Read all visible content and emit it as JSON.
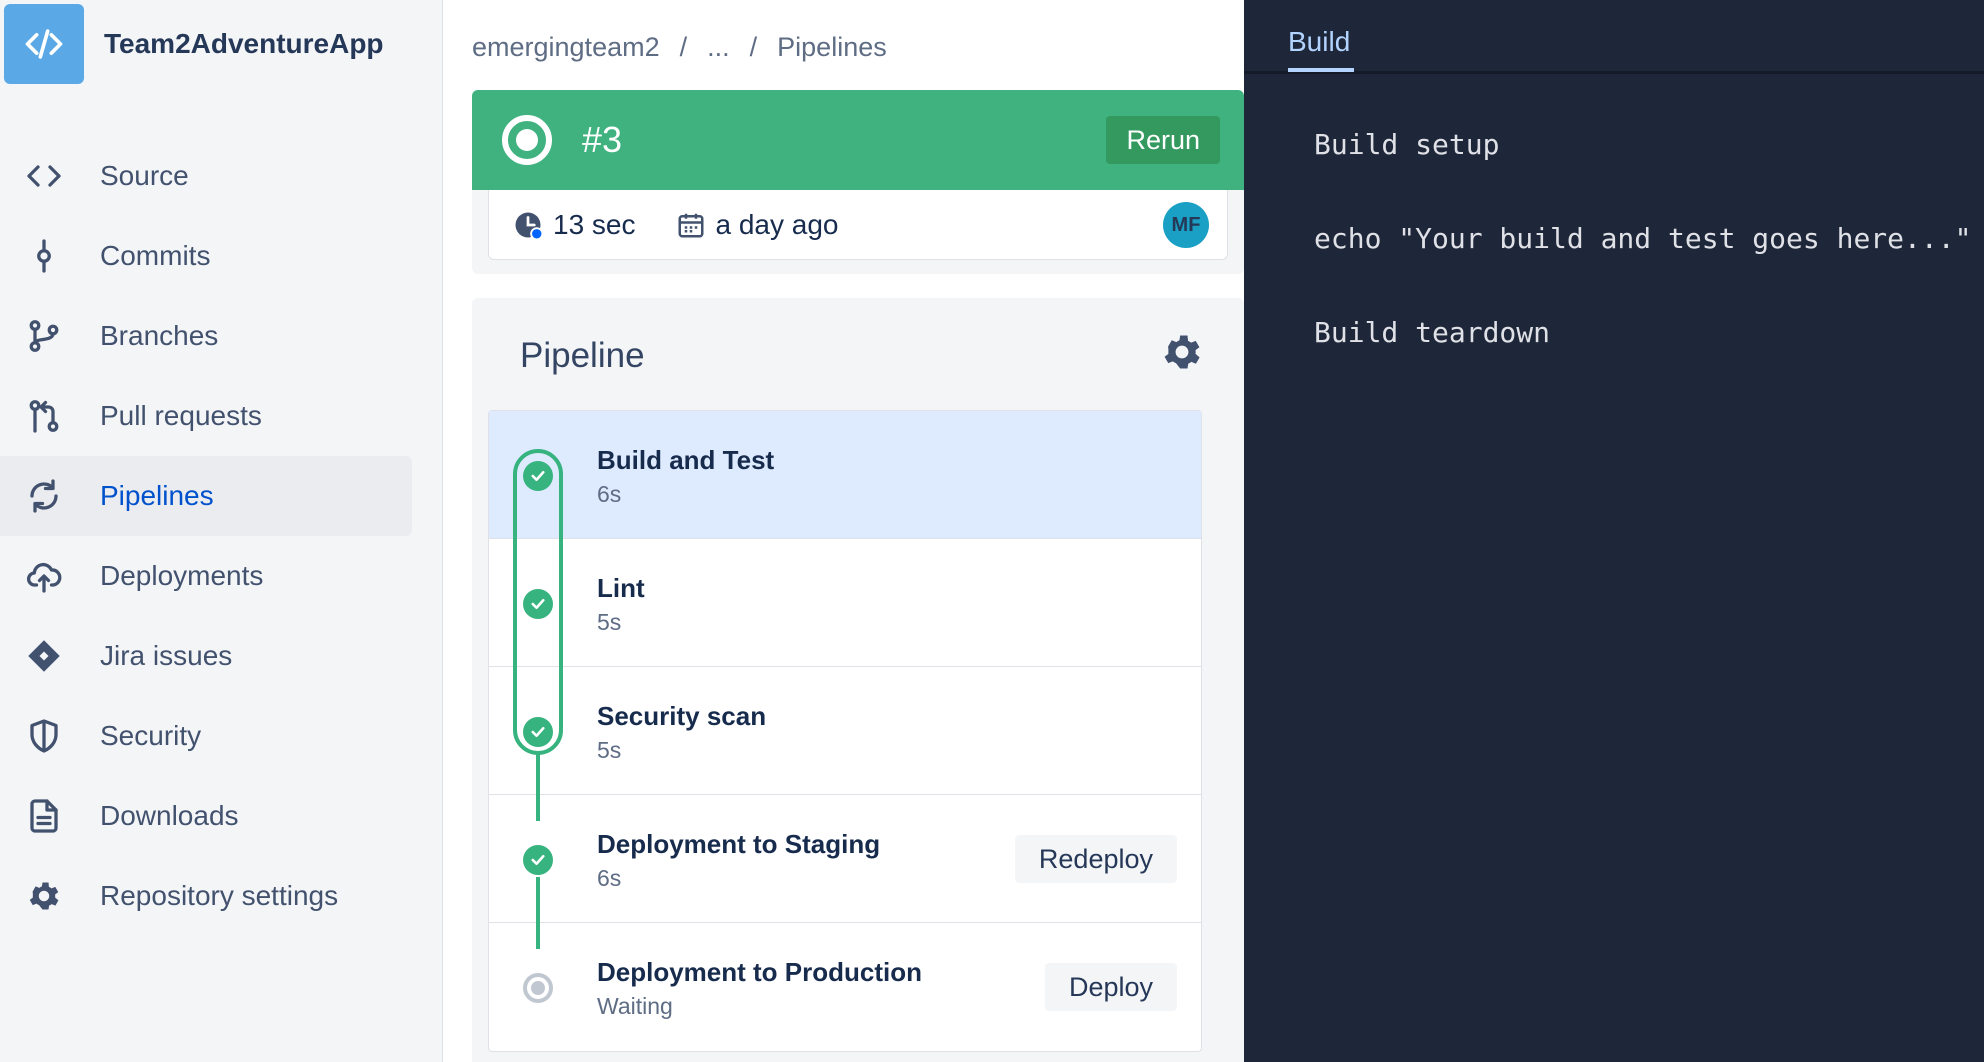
{
  "repo": {
    "name": "Team2AdventureApp"
  },
  "nav": [
    {
      "label": "Source",
      "icon": "code-icon"
    },
    {
      "label": "Commits",
      "icon": "commit-icon"
    },
    {
      "label": "Branches",
      "icon": "branch-icon"
    },
    {
      "label": "Pull requests",
      "icon": "pull-request-icon"
    },
    {
      "label": "Pipelines",
      "icon": "pipelines-icon",
      "active": true
    },
    {
      "label": "Deployments",
      "icon": "cloud-upload-icon"
    },
    {
      "label": "Jira issues",
      "icon": "jira-icon"
    },
    {
      "label": "Security",
      "icon": "shield-icon"
    },
    {
      "label": "Downloads",
      "icon": "document-icon"
    },
    {
      "label": "Repository settings",
      "icon": "gear-icon"
    }
  ],
  "breadcrumb": {
    "workspace": "emergingteam2",
    "sep1": "/",
    "ellipsis": "...",
    "sep2": "/",
    "current": "Pipelines"
  },
  "run": {
    "number": "#3",
    "rerun_label": "Rerun",
    "duration": "13 sec",
    "when": "a day ago",
    "avatar_initials": "MF",
    "status_color": "#3fb27f"
  },
  "pipeline": {
    "title": "Pipeline",
    "steps": [
      {
        "name": "Build and Test",
        "duration": "6s",
        "status": "success"
      },
      {
        "name": "Lint",
        "duration": "5s",
        "status": "success"
      },
      {
        "name": "Security scan",
        "duration": "5s",
        "status": "success"
      },
      {
        "name": "Deployment to Staging",
        "duration": "6s",
        "status": "success",
        "action": "Redeploy"
      },
      {
        "name": "Deployment to Production",
        "duration": "Waiting",
        "status": "pending",
        "action": "Deploy"
      }
    ]
  },
  "log": {
    "tab": "Build",
    "lines": [
      "Build setup",
      "echo \"Your build and test goes here...\"",
      "Build teardown"
    ]
  }
}
